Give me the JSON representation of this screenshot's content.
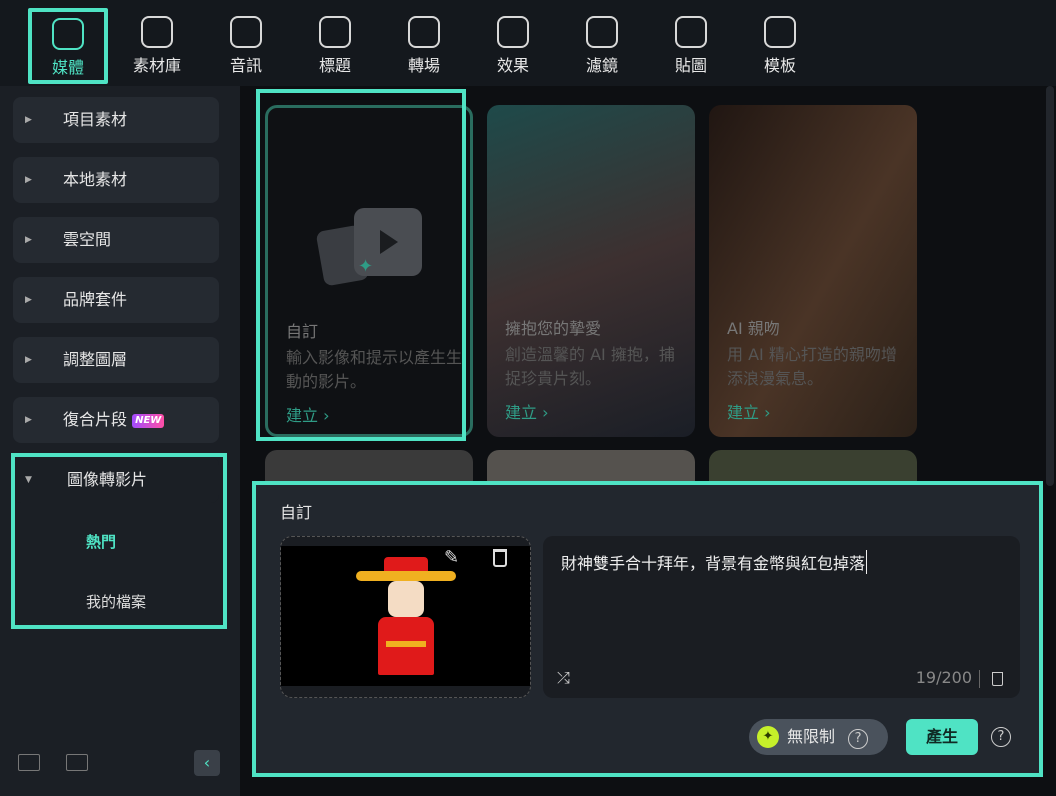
{
  "toolbar": {
    "tabs": [
      {
        "label": "媒體",
        "icon": "media-icon"
      },
      {
        "label": "素材庫",
        "icon": "store-icon"
      },
      {
        "label": "音訊",
        "icon": "music-icon"
      },
      {
        "label": "標題",
        "icon": "text-icon"
      },
      {
        "label": "轉場",
        "icon": "transition-icon"
      },
      {
        "label": "效果",
        "icon": "effects-icon"
      },
      {
        "label": "濾鏡",
        "icon": "filter-icon"
      },
      {
        "label": "貼圖",
        "icon": "sticker-icon"
      },
      {
        "label": "模板",
        "icon": "template-icon"
      }
    ],
    "active": "媒體"
  },
  "sidebar": {
    "items": [
      {
        "label": "項目素材"
      },
      {
        "label": "本地素材"
      },
      {
        "label": "雲空間"
      },
      {
        "label": "品牌套件"
      },
      {
        "label": "調整圖層"
      },
      {
        "label": "復合片段",
        "badge": "NEW"
      },
      {
        "label": "圖像轉影片"
      }
    ],
    "subitems": [
      {
        "label": "熱門",
        "active": true
      },
      {
        "label": "我的檔案"
      }
    ]
  },
  "cards": [
    {
      "title": "自訂",
      "desc": "輸入影像和提示以產生生動的影片。",
      "cta": "建立 ›"
    },
    {
      "title": "擁抱您的摯愛",
      "desc": "創造溫馨的 AI 擁抱，捕捉珍貴片刻。",
      "cta": "建立 ›"
    },
    {
      "title": "AI 親吻",
      "desc": "用 AI 精心打造的親吻增添浪漫氣息。",
      "cta": "建立 ›"
    }
  ],
  "panel": {
    "title": "自訂",
    "prompt": "財神雙手合十拜年，背景有金幣與紅包掉落",
    "count": "19/200",
    "mode": "無限制",
    "generate": "產生"
  },
  "colors": {
    "accent": "#4fe3c4"
  }
}
